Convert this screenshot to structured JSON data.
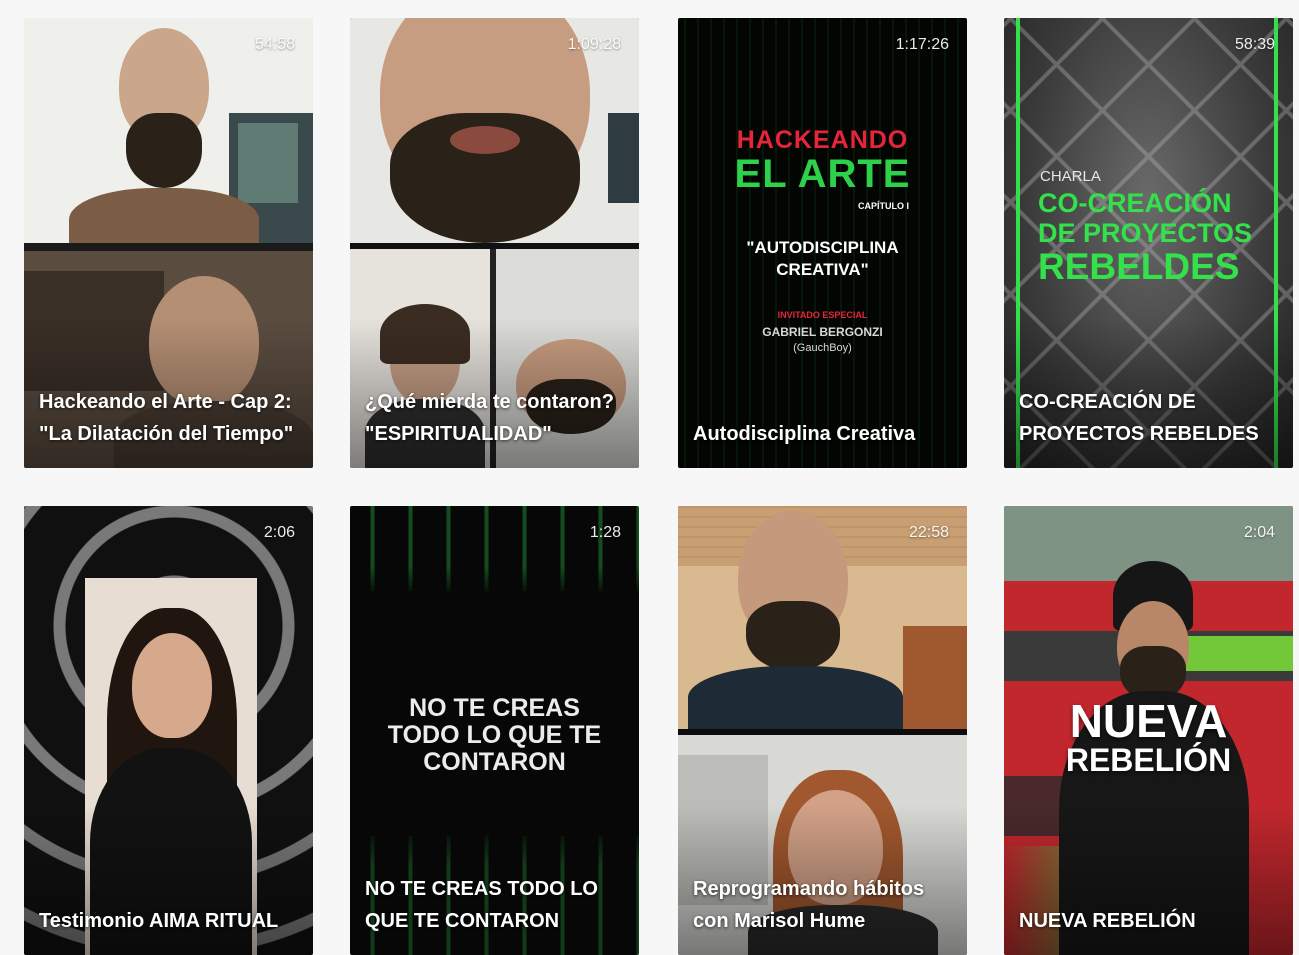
{
  "videos": [
    {
      "title": "Hackeando el Arte - Cap 2: \"La Dilatación del Tiempo\"",
      "duration": "54:58"
    },
    {
      "title": "¿Qué mierda te contaron? \"ESPIRITUALIDAD\"",
      "duration": "1:09:28"
    },
    {
      "title": "Autodisciplina Creativa",
      "duration": "1:17:26"
    },
    {
      "title": "CO-CREACIÓN DE PROYECTOS REBELDES",
      "duration": "58:39"
    },
    {
      "title": "Testimonio AIMA RITUAL",
      "duration": "2:06"
    },
    {
      "title": "NO TE CREAS TODO LO QUE TE CONTARON",
      "duration": "1:28"
    },
    {
      "title": "Reprogramando hábitos con Marisol Hume",
      "duration": "22:58"
    },
    {
      "title": "NUEVA REBELIÓN",
      "duration": "2:04"
    }
  ],
  "posters": {
    "hackeando": {
      "line1": "HACKEANDO",
      "line2": "EL ARTE",
      "chapter": "CAPÍTULO I",
      "quote1": "\"AUTODISCIPLINA",
      "quote2": "CREATIVA\"",
      "guest_label": "INVITADO ESPECIAL",
      "guest_name": "GABRIEL BERGONZI",
      "guest_alias": "(GauchBoy)",
      "primary_color": "#e8243b",
      "secondary_color": "#2ed14a"
    },
    "cocreacion": {
      "kicker": "CHARLA",
      "line1": "CO-CREACIÓN",
      "line2": "DE PROYECTOS",
      "line3": "REBELDES",
      "accent_color": "#33e24a"
    },
    "no_te_creas": {
      "line1": "NO TE CREAS",
      "line2": "TODO LO QUE TE",
      "line3": "CONTARON"
    },
    "nueva_rebelion": {
      "line1": "NUEVA",
      "line2": "REBELIÓN"
    }
  }
}
